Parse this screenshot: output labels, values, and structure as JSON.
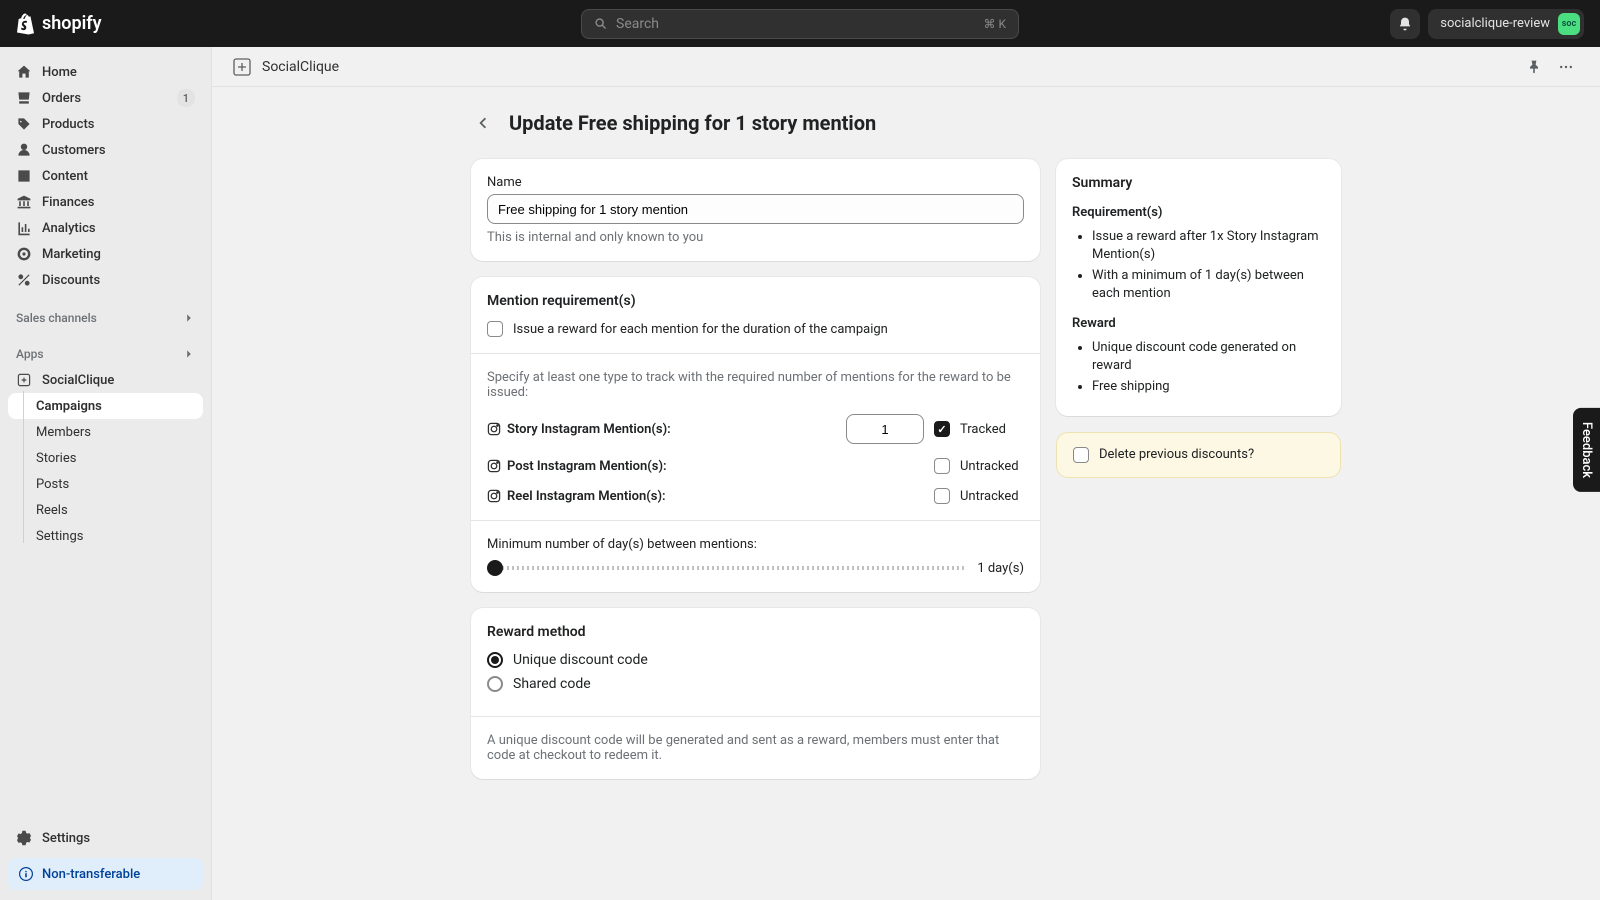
{
  "topbar": {
    "logo_text": "shopify",
    "search_placeholder": "Search",
    "search_shortcut": "⌘ K",
    "store_name": "socialclique-review",
    "avatar_initials": "soc"
  },
  "sidebar": {
    "items": [
      {
        "label": "Home",
        "icon": "home"
      },
      {
        "label": "Orders",
        "icon": "orders",
        "badge": "1"
      },
      {
        "label": "Products",
        "icon": "products"
      },
      {
        "label": "Customers",
        "icon": "customers"
      },
      {
        "label": "Content",
        "icon": "content"
      },
      {
        "label": "Finances",
        "icon": "finances"
      },
      {
        "label": "Analytics",
        "icon": "analytics"
      },
      {
        "label": "Marketing",
        "icon": "marketing"
      },
      {
        "label": "Discounts",
        "icon": "discounts"
      }
    ],
    "sales_channels_label": "Sales channels",
    "apps_label": "Apps",
    "app_name": "SocialClique",
    "app_subs": [
      {
        "label": "Campaigns",
        "active": true
      },
      {
        "label": "Members"
      },
      {
        "label": "Stories"
      },
      {
        "label": "Posts"
      },
      {
        "label": "Reels"
      },
      {
        "label": "Settings"
      }
    ],
    "settings_label": "Settings",
    "nontransferable_label": "Non-transferable"
  },
  "page_header": {
    "app_name": "SocialClique"
  },
  "page": {
    "title": "Update Free shipping for 1 story mention",
    "name_label": "Name",
    "name_value": "Free shipping for 1 story mention",
    "name_help": "This is internal and only known to you",
    "mention_req_title": "Mention requirement(s)",
    "issue_each_label": "Issue a reward for each mention for the duration of the campaign",
    "specify_help": "Specify at least one type to track with the required number of mentions for the reward to be issued:",
    "mentions": {
      "story": {
        "label": "Story Instagram Mention(s):",
        "value": "1",
        "tracked": true,
        "track_label": "Tracked"
      },
      "post": {
        "label": "Post Instagram Mention(s):",
        "tracked": false,
        "track_label": "Untracked"
      },
      "reel": {
        "label": "Reel Instagram Mention(s):",
        "tracked": false,
        "track_label": "Untracked"
      }
    },
    "min_days_label": "Minimum number of day(s) between mentions:",
    "min_days_value": "1 day(s)",
    "reward_method_title": "Reward method",
    "reward_options": {
      "unique": "Unique discount code",
      "shared": "Shared code"
    },
    "reward_help": "A unique discount code will be generated and sent as a reward, members must enter that code at checkout to redeem it."
  },
  "summary": {
    "title": "Summary",
    "req_title": "Requirement(s)",
    "req_items": [
      "Issue a reward after 1x Story Instagram Mention(s)",
      "With a minimum of 1 day(s) between each mention"
    ],
    "reward_title": "Reward",
    "reward_items": [
      "Unique discount code generated on reward",
      "Free shipping"
    ],
    "delete_prev_label": "Delete previous discounts?"
  },
  "feedback_label": "Feedback"
}
